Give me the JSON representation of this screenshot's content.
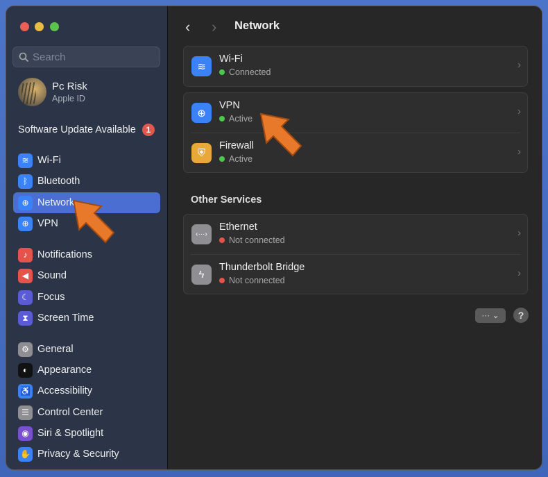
{
  "sidebar": {
    "search_placeholder": "Search",
    "user": {
      "name": "Pc Risk",
      "subtitle": "Apple ID"
    },
    "software_update": {
      "label": "Software Update Available",
      "badge": "1"
    },
    "items": [
      {
        "label": "Wi-Fi",
        "icon": "wifi-icon",
        "color": "#3b82f6"
      },
      {
        "label": "Bluetooth",
        "icon": "bluetooth-icon",
        "color": "#3b82f6"
      },
      {
        "label": "Network",
        "icon": "globe-icon",
        "color": "#3b82f6",
        "selected": true
      },
      {
        "label": "VPN",
        "icon": "vpn-globe-icon",
        "color": "#3b82f6"
      },
      {
        "label": "Notifications",
        "icon": "bell-icon",
        "color": "#e5534b"
      },
      {
        "label": "Sound",
        "icon": "speaker-icon",
        "color": "#e5534b"
      },
      {
        "label": "Focus",
        "icon": "moon-icon",
        "color": "#5b5bd6"
      },
      {
        "label": "Screen Time",
        "icon": "hourglass-icon",
        "color": "#5b5bd6"
      },
      {
        "label": "General",
        "icon": "gear-icon",
        "color": "#8e8e93"
      },
      {
        "label": "Appearance",
        "icon": "appearance-icon",
        "color": "#111111"
      },
      {
        "label": "Accessibility",
        "icon": "accessibility-icon",
        "color": "#3b82f6"
      },
      {
        "label": "Control Center",
        "icon": "control-center-icon",
        "color": "#8e8e93"
      },
      {
        "label": "Siri & Spotlight",
        "icon": "siri-icon",
        "color": "#7a4fd0"
      },
      {
        "label": "Privacy & Security",
        "icon": "hand-icon",
        "color": "#3b82f6"
      }
    ]
  },
  "main": {
    "title": "Network",
    "back": "‹",
    "forward": "›",
    "groups": [
      [
        {
          "title": "Wi-Fi",
          "status": "Connected",
          "ok": true,
          "icon": "wifi-icon"
        }
      ],
      [
        {
          "title": "VPN",
          "status": "Active",
          "ok": true,
          "icon": "vpn-globe-icon"
        },
        {
          "title": "Firewall",
          "status": "Active",
          "ok": true,
          "icon": "shield-icon"
        }
      ]
    ],
    "other_services_label": "Other Services",
    "other": [
      {
        "title": "Ethernet",
        "status": "Not connected",
        "ok": false,
        "icon": "ethernet-icon"
      },
      {
        "title": "Thunderbolt Bridge",
        "status": "Not connected",
        "ok": false,
        "icon": "thunderbolt-icon"
      }
    ],
    "more_label": "··· ⌄",
    "help_label": "?"
  },
  "colors": {
    "accent": "#4b6ed3",
    "green": "#4cc94c",
    "red": "#e5534b",
    "arrow": "#e8782a"
  }
}
